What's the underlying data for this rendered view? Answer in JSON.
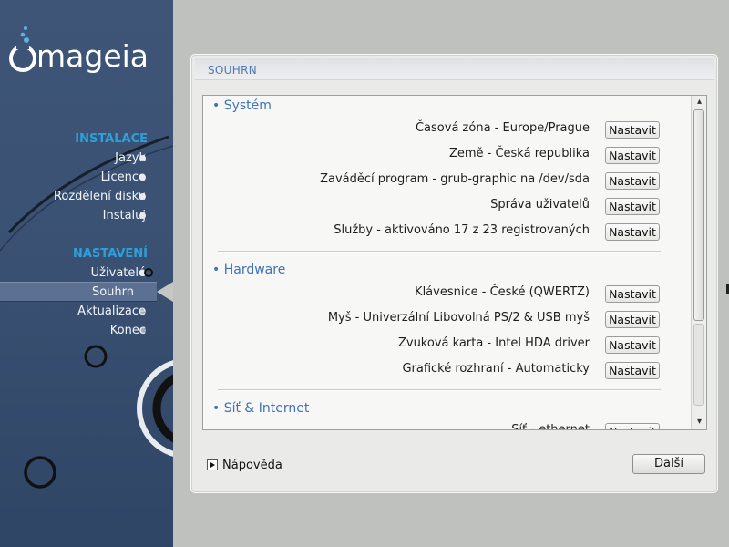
{
  "brand": {
    "logo_text": "mageia"
  },
  "sidebar": {
    "sections": [
      {
        "title": "INSTALACE",
        "items": [
          {
            "label": "Jazyk"
          },
          {
            "label": "Licence"
          },
          {
            "label": "Rozdělení disku"
          },
          {
            "label": "Instaluj"
          }
        ]
      },
      {
        "title": "NASTAVENÍ",
        "items": [
          {
            "label": "Uživatelé"
          },
          {
            "label": "Souhrn"
          },
          {
            "label": "Aktualizace"
          },
          {
            "label": "Konec"
          }
        ]
      }
    ],
    "active_item": "Souhrn"
  },
  "panel": {
    "title": "SOUHRN",
    "categories": [
      {
        "title": "• Systém",
        "rows": [
          {
            "label": "Časová zóna - Europe/Prague",
            "button": "Nastavit"
          },
          {
            "label": "Země - Česká republika",
            "button": "Nastavit"
          },
          {
            "label": "Zaváděcí program - grub-graphic na /dev/sda",
            "button": "Nastavit"
          },
          {
            "label": "Správa uživatelů",
            "button": "Nastavit"
          },
          {
            "label": "Služby - aktivováno 17 z 23 registrovaných",
            "button": "Nastavit"
          }
        ]
      },
      {
        "title": "• Hardware",
        "rows": [
          {
            "label": "Klávesnice - České (QWERTZ)",
            "button": "Nastavit"
          },
          {
            "label": "Myš - Univerzální Libovolná PS/2 & USB myš",
            "button": "Nastavit"
          },
          {
            "label": "Zvuková karta - Intel HDA driver",
            "button": "Nastavit"
          },
          {
            "label": "Grafické rozhraní - Automaticky",
            "button": "Nastavit"
          }
        ]
      },
      {
        "title": "• Síť & Internet",
        "rows": [
          {
            "label": "Síť - ethernet",
            "button": "Nastavit"
          }
        ]
      }
    ],
    "scroll_up_icon": "chevron-up-icon",
    "scroll_down_icon": "chevron-down-icon"
  },
  "footer": {
    "help_label": "Nápověda",
    "next_label": "Další"
  },
  "colors": {
    "accent": "#3f72b6",
    "sidebar_section": "#2ea0d8",
    "sidebar_bg": "#3a5173"
  }
}
